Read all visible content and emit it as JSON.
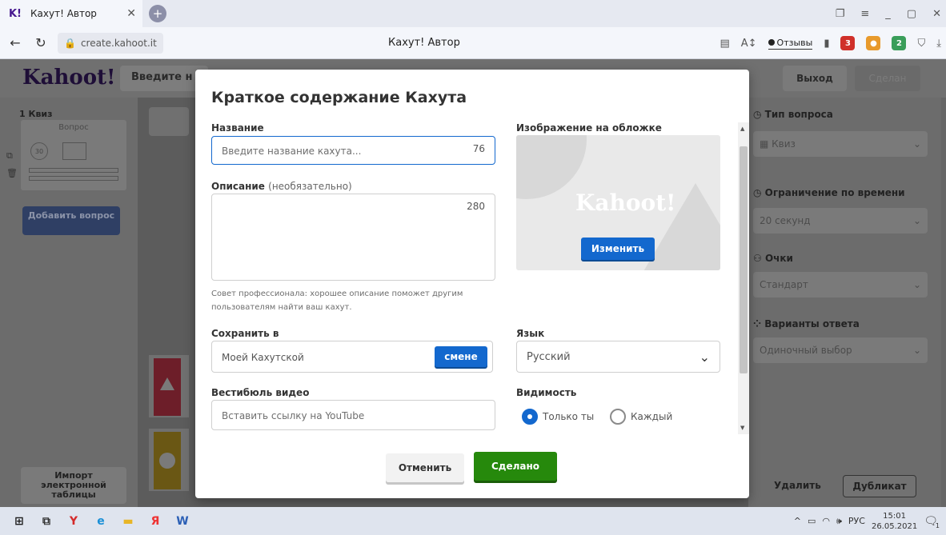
{
  "browser": {
    "tab_title": "Кахут! Автор",
    "tab_favicon": "K!",
    "url": "create.kahoot.it",
    "page_title": "Кахут! Автор",
    "feedback": "Отзывы",
    "ext_badge_1": "3",
    "ext_badge_2": "2"
  },
  "kahoot": {
    "logo": "Kahoot!",
    "title_input": "Введите н",
    "exit": "Выход",
    "done": "Сделан",
    "sidebar": {
      "quiz_label": "1 Квиз",
      "question": "Вопрос",
      "time_badge": "30",
      "add_question": "Добавить вопрос",
      "import": "Импорт электронной таблицы"
    },
    "right": {
      "question_type_label": "Тип вопроса",
      "question_type_value": "Квиз",
      "time_limit_label": "Ограничение по времени",
      "time_limit_value": "20 секунд",
      "points_label": "Очки",
      "points_value": "Стандарт",
      "answers_label": "Варианты ответа",
      "answers_value": "Одиночный выбор",
      "delete": "Удалить",
      "duplicate": "Дубликат"
    }
  },
  "modal": {
    "title": "Краткое содержание Кахута",
    "name_label": "Название",
    "name_placeholder": "Введите название кахута...",
    "name_counter": "76",
    "desc_label": "Описание",
    "desc_optional": "(необязательно)",
    "desc_counter": "280",
    "tip": "Совет профессионала: хорошее описание поможет другим пользователям найти ваш кахут.",
    "cover_label": "Изображение на обложке",
    "cover_logo": "Kahoot!",
    "cover_change": "Изменить",
    "save_label": "Сохранить в",
    "save_value": "Моей Кахутской",
    "save_change": "смене",
    "language_label": "Язык",
    "language_value": "Русский",
    "video_label": "Вестибюль видео",
    "video_placeholder": "Вставить ссылку на YouTube",
    "visibility_label": "Видимость",
    "visibility_options": [
      "Только ты",
      "Каждый"
    ],
    "visibility_selected": "Только ты",
    "cancel": "Отменить",
    "done": "Сделано"
  },
  "taskbar": {
    "lang": "РУС",
    "time": "15:01",
    "date": "26.05.2021",
    "notif_count": "1"
  },
  "colors": {
    "primary_blue": "#1368ce",
    "done_green": "#26890c",
    "answer_red": "#e21b3c",
    "answer_yellow": "#d89e00"
  }
}
